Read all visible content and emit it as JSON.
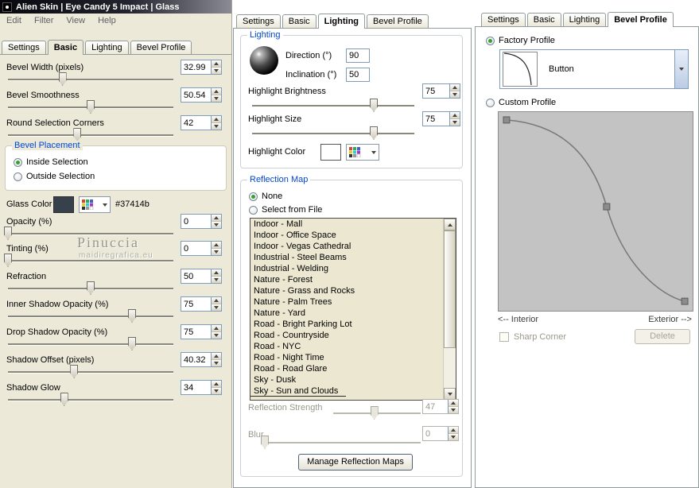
{
  "colors": {
    "xp_background": "#ece9d8",
    "group_label_blue": "#0046d5",
    "glass_color": "#37414b",
    "listbox_background": "#ebe7d1",
    "curve_editor_background": "#c3c3c3"
  },
  "icons": {
    "app": "app-icon",
    "spin_up": "▲",
    "spin_down": "▼",
    "dropdown_arrow": "▼",
    "scroll_up": "▲",
    "scroll_down": "▼",
    "color_palette": "palette-grid-icon"
  },
  "window": {
    "title": "Alien Skin  |  Eye Candy 5 Impact  |  Glass"
  },
  "menubar": {
    "items": [
      "Edit",
      "Filter",
      "View",
      "Help"
    ]
  },
  "tabs": [
    "Settings",
    "Basic",
    "Lighting",
    "Bevel Profile"
  ],
  "left": {
    "active_tab": "Basic",
    "sliders_top": [
      {
        "label": "Bevel Width (pixels)",
        "value": "32.99"
      },
      {
        "label": "Bevel Smoothness",
        "value": "50.54"
      },
      {
        "label": "Round Selection Corners",
        "value": "42"
      }
    ],
    "bevel_placement": {
      "title": "Bevel Placement",
      "options": [
        {
          "label": "Inside Selection",
          "selected": true
        },
        {
          "label": "Outside Selection",
          "selected": false
        }
      ]
    },
    "glass_color": {
      "label": "Glass Color",
      "hex": "#37414b"
    },
    "sliders_bottom": [
      {
        "label": "Opacity (%)",
        "value": "0"
      },
      {
        "label": "Tinting (%)",
        "value": "0"
      },
      {
        "label": "Refraction",
        "value": "50"
      },
      {
        "label": "Inner Shadow Opacity (%)",
        "value": "75"
      },
      {
        "label": "Drop Shadow Opacity (%)",
        "value": "75"
      },
      {
        "label": "Shadow Offset (pixels)",
        "value": "40.32"
      },
      {
        "label": "Shadow Glow",
        "value": "34"
      }
    ],
    "watermark": {
      "line1": "Pinuccia",
      "line2": "maidiregrafica.eu"
    }
  },
  "middle": {
    "active_tab": "Lighting",
    "lighting": {
      "title": "Lighting",
      "direction_label": "Direction (°)",
      "direction_value": "90",
      "inclination_label": "Inclination (°)",
      "inclination_value": "50",
      "highlight_brightness_label": "Highlight Brightness",
      "highlight_brightness_value": "75",
      "highlight_size_label": "Highlight Size",
      "highlight_size_value": "75",
      "highlight_color_label": "Highlight Color"
    },
    "reflection": {
      "title": "Reflection Map",
      "option_none": "None",
      "option_file": "Select from File",
      "list": [
        "Indoor - Mall",
        "Indoor - Office Space",
        "Indoor - Vegas Cathedral",
        "Industrial - Steel Beams",
        "Industrial - Welding",
        "Nature - Forest",
        "Nature - Grass and Rocks",
        "Nature - Palm Trees",
        "Nature - Yard",
        "Road - Bright Parking Lot",
        "Road - Countryside",
        "Road - NYC",
        "Road - Night Time",
        "Road - Road Glare",
        "Sky - Dusk",
        "Sky - Sun and Clouds"
      ],
      "strength_label": "Reflection Strength",
      "strength_value": "47",
      "blur_label": "Blur",
      "blur_value": "0",
      "manage_button": "Manage Reflection Maps"
    }
  },
  "right": {
    "active_tab": "Bevel Profile",
    "factory_label": "Factory Profile",
    "profile_name": "Button",
    "custom_label": "Custom Profile",
    "interior_label": "<-- Interior",
    "exterior_label": "Exterior -->",
    "sharp_corner_label": "Sharp Corner",
    "delete_button": "Delete"
  }
}
